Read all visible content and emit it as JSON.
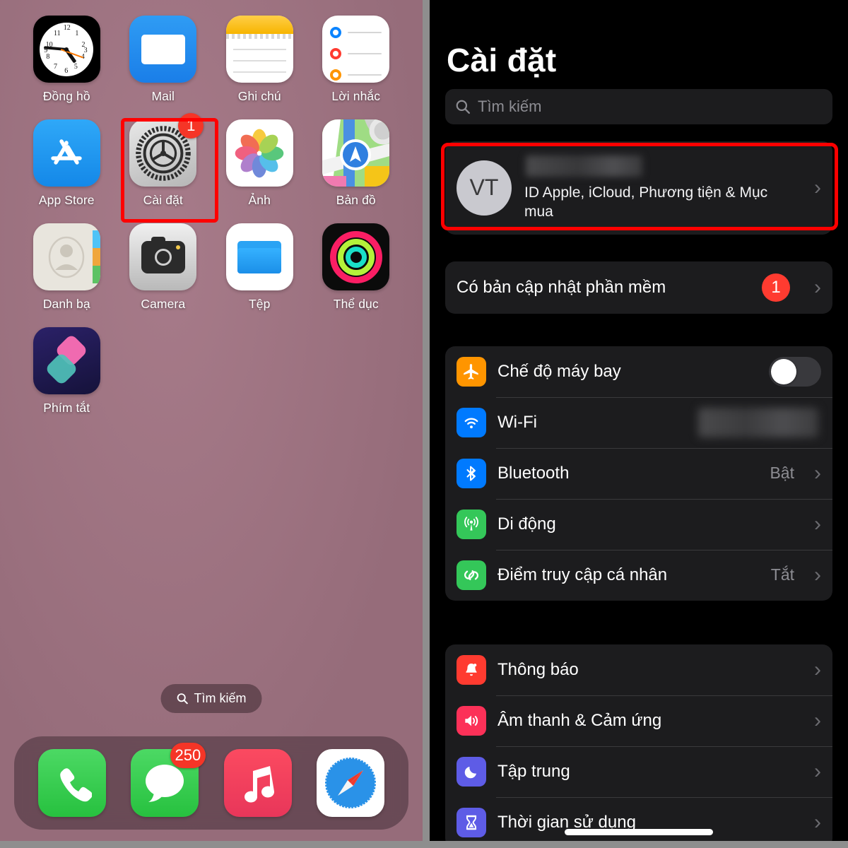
{
  "home": {
    "wallpaper_color": "#9d7280",
    "apps": [
      {
        "label": "Đồng hồ",
        "icon": "clock-icon",
        "badge": null,
        "highlighted": false
      },
      {
        "label": "Mail",
        "icon": "mail-icon",
        "badge": null,
        "highlighted": false
      },
      {
        "label": "Ghi chú",
        "icon": "notes-icon",
        "badge": null,
        "highlighted": false
      },
      {
        "label": "Lời nhắc",
        "icon": "reminders-icon",
        "badge": null,
        "highlighted": false
      },
      {
        "label": "App Store",
        "icon": "app-store-icon",
        "badge": null,
        "highlighted": false
      },
      {
        "label": "Cài đặt",
        "icon": "settings-gear-icon",
        "badge": "1",
        "highlighted": true
      },
      {
        "label": "Ảnh",
        "icon": "photos-icon",
        "badge": null,
        "highlighted": false
      },
      {
        "label": "Bản đồ",
        "icon": "maps-icon",
        "badge": null,
        "highlighted": false
      },
      {
        "label": "Danh bạ",
        "icon": "contacts-icon",
        "badge": null,
        "highlighted": false
      },
      {
        "label": "Camera",
        "icon": "camera-icon",
        "badge": null,
        "highlighted": false
      },
      {
        "label": "Tệp",
        "icon": "files-folder-icon",
        "badge": null,
        "highlighted": false
      },
      {
        "label": "Thể dục",
        "icon": "fitness-rings-icon",
        "badge": null,
        "highlighted": false
      },
      {
        "label": "Phím tắt",
        "icon": "shortcuts-icon",
        "badge": null,
        "highlighted": false
      }
    ],
    "search_pill": {
      "label": "Tìm kiếm",
      "icon": "search-icon"
    },
    "dock": [
      {
        "name": "phone",
        "icon": "phone-icon",
        "badge": null
      },
      {
        "name": "messages",
        "icon": "messages-bubble-icon",
        "badge": "250"
      },
      {
        "name": "music",
        "icon": "music-note-icon",
        "badge": null
      },
      {
        "name": "safari",
        "icon": "safari-compass-icon",
        "badge": null
      }
    ]
  },
  "settings": {
    "title": "Cài đặt",
    "search": {
      "placeholder": "Tìm kiếm",
      "icon": "search-icon",
      "value": ""
    },
    "account": {
      "initials": "VT",
      "name_redacted": true,
      "subtitle": "ID Apple, iCloud, Phương tiện & Mục mua",
      "chevron": "chevron-right-icon",
      "highlighted": true
    },
    "update": {
      "label": "Có bản cập nhật phần mềm",
      "badge": "1",
      "chevron": "chevron-right-icon"
    },
    "group_connectivity": [
      {
        "label": "Chế độ máy bay",
        "icon": "airplane-icon",
        "icon_color": "#ff9500",
        "control": "toggle",
        "toggle_on": false
      },
      {
        "label": "Wi-Fi",
        "icon": "wifi-icon",
        "icon_color": "#007aff",
        "control": "redacted-value"
      },
      {
        "label": "Bluetooth",
        "icon": "bluetooth-icon",
        "icon_color": "#007aff",
        "control": "value",
        "value": "Bật"
      },
      {
        "label": "Di động",
        "icon": "cellular-icon",
        "icon_color": "#34c759",
        "control": "chevron"
      },
      {
        "label": "Điểm truy cập cá nhân",
        "icon": "hotspot-icon",
        "icon_color": "#34c759",
        "control": "value",
        "value": "Tắt"
      }
    ],
    "group_system": [
      {
        "label": "Thông báo",
        "icon": "notifications-bell-icon",
        "icon_color": "#ff3b30",
        "control": "chevron"
      },
      {
        "label": "Âm thanh & Cảm ứng",
        "icon": "sound-speaker-icon",
        "icon_color": "#fc3158",
        "control": "chevron"
      },
      {
        "label": "Tập trung",
        "icon": "focus-moon-icon",
        "icon_color": "#5e5ce6",
        "control": "chevron"
      },
      {
        "label": "Thời gian sử dụng",
        "icon": "screen-time-hourglass-icon",
        "icon_color": "#5e5ce6",
        "control": "chevron"
      }
    ],
    "colors": {
      "accent_red": "#ff0000",
      "badge_red": "#ff3b30",
      "card": "#1c1c1e",
      "background": "#000000"
    }
  }
}
